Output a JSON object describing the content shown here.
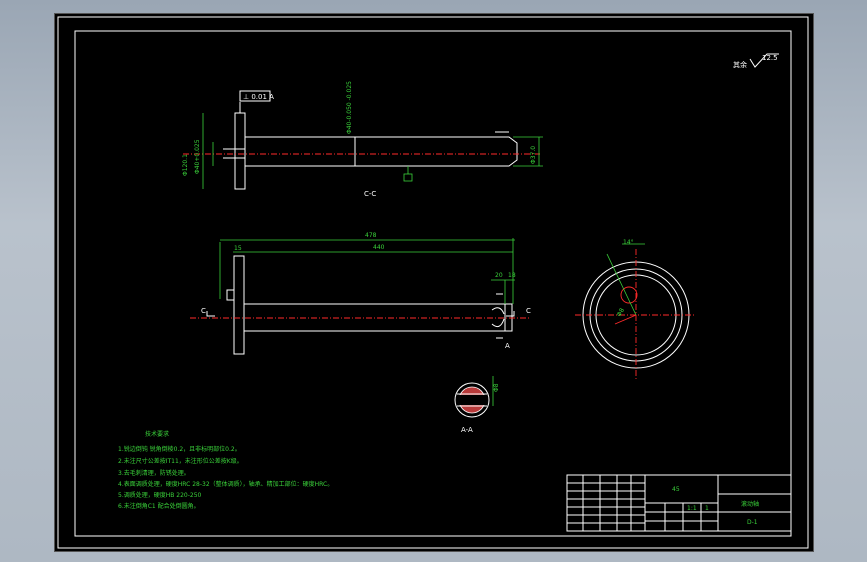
{
  "drawing": {
    "roughness": {
      "label": "其余",
      "value": "12.5"
    },
    "tolerance_frame": "⊥ 0.01 A",
    "section_cc": {
      "label": "C-C"
    },
    "section_aa": {
      "label": "A-A"
    },
    "dims": {
      "overall_length": "478",
      "shaft_length": "440",
      "flange_thickness": "15",
      "slot_a": "20",
      "slot_b": "18",
      "shaft_dia": "Φ40-0.050 -0.025",
      "flange_dia": "Φ120.1",
      "bore_dia": "Φ40+0.025",
      "end_dia": "Φ37.0",
      "hole_dia": "Φ8",
      "angle": "14°",
      "pin_dia": "Φ8",
      "cut_c": "C",
      "cut_a": "A"
    },
    "tech_req": {
      "title": "技术要求",
      "lines": [
        "1.锐边倒钝 锐角倒棱0.2，且非标明部位0.2。",
        "2.未注尺寸公差按IT11，未注形位公差按K级。",
        "3.去毛刺清理，防锈处理。",
        "4.表面调质处理，硬度HRC 28-32（整体调质），轴承、精加工部位：硬度HRC。",
        "5.调质处理，硬度HB 220-250",
        "6.未注倒角C1 配合处倒圆角。"
      ]
    },
    "title_block": {
      "material": "45",
      "part_name": "滚动轴",
      "drawing_no": "D-1",
      "scale": "1:1",
      "sheet": "1"
    }
  }
}
